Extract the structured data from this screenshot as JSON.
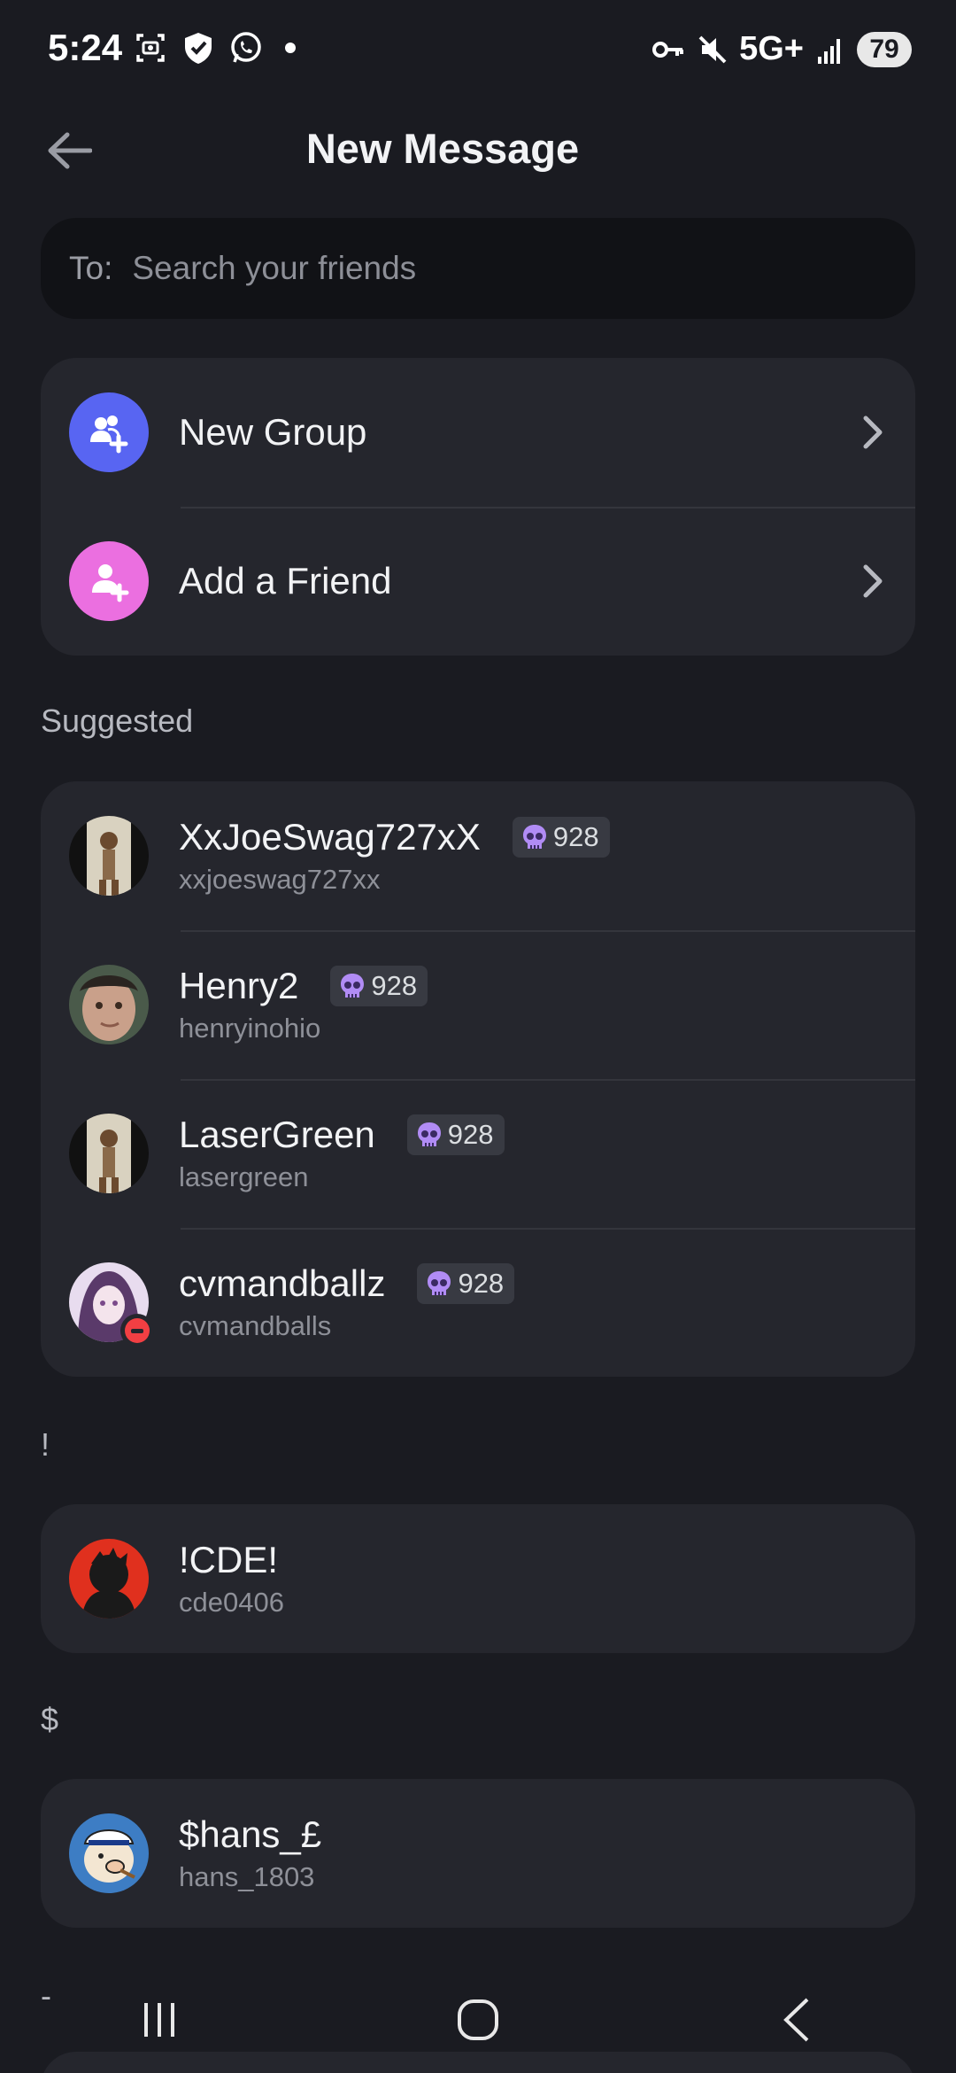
{
  "status_bar": {
    "time": "5:24",
    "network": "5G+",
    "battery": "79"
  },
  "header": {
    "title": "New Message"
  },
  "search": {
    "prefix": "To:",
    "placeholder": "Search your friends"
  },
  "actions": [
    {
      "label": "New Group",
      "icon": "add-group-icon",
      "color": "#5865f2"
    },
    {
      "label": "Add a Friend",
      "icon": "add-friend-icon",
      "color": "#eb6fe0"
    }
  ],
  "sections": {
    "suggested": "Suggested",
    "bang": "!",
    "dollar": "$",
    "dash": "-"
  },
  "suggested": [
    {
      "display_name": "XxJoeSwag727xX",
      "username": "xxjoeswag727xx",
      "tag": "928"
    },
    {
      "display_name": "Henry2",
      "username": "henryinohio",
      "tag": "928"
    },
    {
      "display_name": "LaserGreen",
      "username": "lasergreen",
      "tag": "928"
    },
    {
      "display_name": "cvmandballz",
      "username": "cvmandballs",
      "tag": "928",
      "status": "do-not-disturb"
    }
  ],
  "bang_friends": [
    {
      "display_name": "!CDE!",
      "username": "cde0406"
    }
  ],
  "dollar_friends": [
    {
      "display_name": "$hans_£",
      "username": "hans_1803"
    }
  ],
  "colors": {
    "background": "#1a1b21",
    "card": "#25262d",
    "accent_blurple": "#5865f2",
    "accent_pink": "#eb6fe0",
    "dnd_red": "#f23f43"
  }
}
